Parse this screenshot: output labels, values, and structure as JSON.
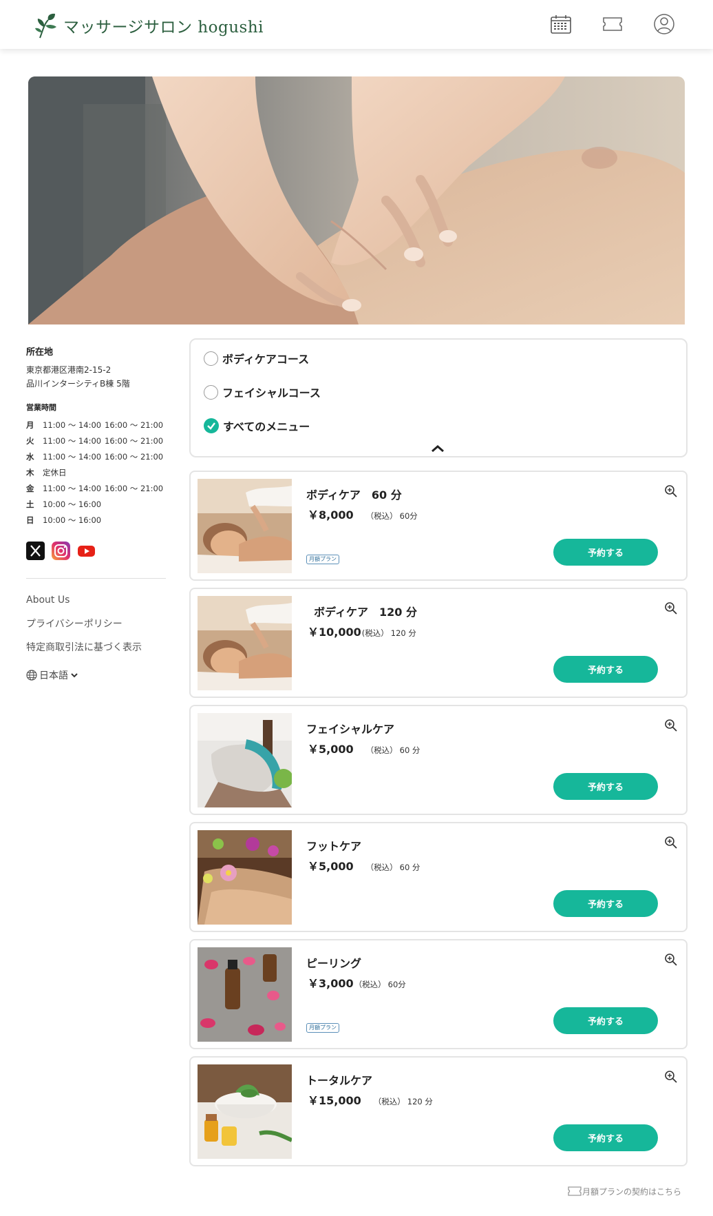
{
  "header": {
    "brand": "マッサージサロン hogushi",
    "icons": [
      "calendar-icon",
      "ticket-icon",
      "user-icon"
    ]
  },
  "sidebar": {
    "location_title": "所在地",
    "address_line1": "東京都港区港南2-15-2",
    "address_line2": "品川インターシティB棟 5階",
    "hours_title": "営業時間",
    "hours": [
      {
        "day": "月",
        "slot1": "11:00 ～ 14:00",
        "slot2": "16:00 ～ 21:00"
      },
      {
        "day": "火",
        "slot1": "11:00 ～ 14:00",
        "slot2": "16:00 ～ 21:00"
      },
      {
        "day": "水",
        "slot1": "11:00 ～ 14:00",
        "slot2": "16:00 ～ 21:00"
      },
      {
        "day": "木",
        "slot1": "定休日",
        "slot2": ""
      },
      {
        "day": "金",
        "slot1": "11:00 ～ 14:00",
        "slot2": "16:00 ～ 21:00"
      },
      {
        "day": "土",
        "slot1": "10:00 ～ 16:00",
        "slot2": ""
      },
      {
        "day": "日",
        "slot1": "10:00 ～ 16:00",
        "slot2": ""
      }
    ],
    "social": [
      "x-icon",
      "instagram-icon",
      "youtube-icon"
    ],
    "links": [
      "About Us",
      "プライバシーポリシー",
      "特定商取引法に基づく表示"
    ],
    "language": "日本語"
  },
  "filter": {
    "options": [
      {
        "label": "ボディケアコース",
        "checked": false
      },
      {
        "label": "フェイシャルコース",
        "checked": false
      },
      {
        "label": "すべてのメニュー",
        "checked": true
      }
    ]
  },
  "menu": [
    {
      "title": "ボディケア　60 分",
      "price": "￥8,000",
      "tax": "（税込）",
      "duration": "60分",
      "badge": "月額プラン",
      "button": "予約する"
    },
    {
      "title": "  ボディケア　120 分",
      "price": "￥10,000",
      "tax": "(税込）",
      "duration": "120 分",
      "badge": "",
      "button": "予約する"
    },
    {
      "title": "フェイシャルケア",
      "price": "￥5,000",
      "tax": "（税込）",
      "duration": "60 分",
      "badge": "",
      "button": "予約する"
    },
    {
      "title": "フットケア",
      "price": "￥5,000",
      "tax": "（税込）",
      "duration": "60 分",
      "badge": "",
      "button": "予約する"
    },
    {
      "title": "ピーリング",
      "price": "￥3,000",
      "tax": "（税込）",
      "duration": "60分",
      "badge": "月額プラン",
      "button": "予約する"
    },
    {
      "title": "トータルケア",
      "price": "￥15,000",
      "tax": "（税込）",
      "duration": "120 分",
      "badge": "",
      "button": "予約する"
    }
  ],
  "footer": {
    "monthly_plan_link": "月額プランの契約はこちら"
  },
  "colors": {
    "accent": "#16b79a",
    "brand": "#2c5f3f",
    "badge": "#2f6e9a"
  }
}
